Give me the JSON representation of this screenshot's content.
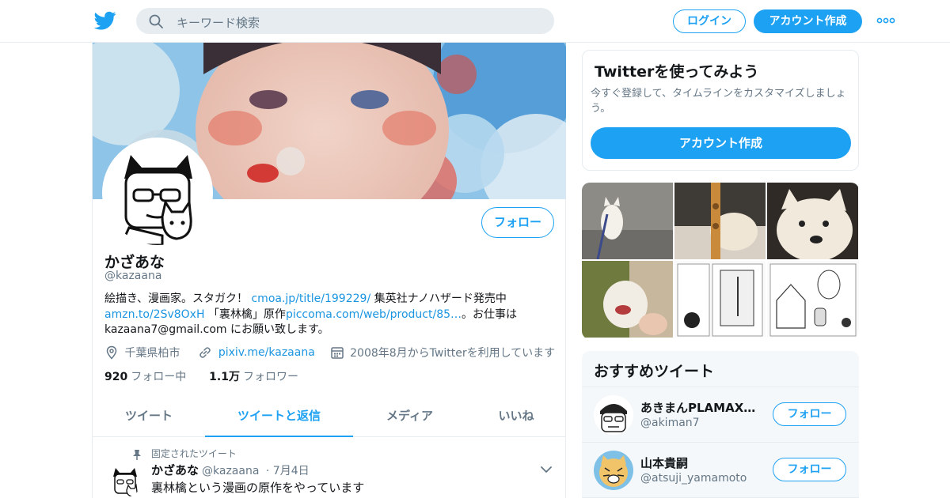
{
  "colors": {
    "brand": "#1da1f2",
    "link": "#1b95e0",
    "muted": "#657786",
    "text": "#14171a",
    "border": "#e6ecf0"
  },
  "header": {
    "logo_icon": "twitter-bird-icon",
    "search_placeholder": "キーワード検索",
    "search_icon": "search-icon",
    "login_label": "ログイン",
    "signup_label": "アカウント作成",
    "more_icon": "more-dots-icon"
  },
  "profile": {
    "name": "かざあな",
    "handle": "@kazaana",
    "follow_label": "フォロー",
    "bio": {
      "t1": "絵描き、漫画家。スタガク！ ",
      "l1": "cmoa.jp/title/199229/",
      "t2": " 集英社ナノハザード発売中",
      "l2": "amzn.to/2Sv8OxH",
      "t3": " 「裏林檎」原作",
      "l3": "piccoma.com/web/product/85…",
      "t4": "。お仕事は kazaana7@gmail.com にお願い致します。"
    },
    "location": "千葉県柏市",
    "website": "pixiv.me/kazaana",
    "joined": "2008年8月からTwitterを利用しています",
    "following_count": "920",
    "following_label": "フォロー中",
    "followers_count": "1.1万",
    "followers_label": "フォロワー"
  },
  "tabs": [
    {
      "label": "ツイート",
      "active": false
    },
    {
      "label": "ツイートと返信",
      "active": true
    },
    {
      "label": "メディア",
      "active": false
    },
    {
      "label": "いいね",
      "active": false
    }
  ],
  "pinned_tweet": {
    "pinned_label": "固定されたツイート",
    "name": "かざあな",
    "handle": "@kazaana",
    "date": "7月4日",
    "text": "裏林檎という漫画の原作をやっています"
  },
  "signup_card": {
    "title": "Twitterを使ってみよう",
    "description": "今すぐ登録して、タイムラインをカスタマイズしましょう。",
    "button_label": "アカウント作成"
  },
  "recommended": {
    "heading": "おすすめツイート",
    "items": [
      {
        "name": "あきまんPLAMAX「…",
        "handle": "@akiman7",
        "follow_label": "フォロー"
      },
      {
        "name": "山本貴嗣",
        "handle": "@atsuji_yamamoto",
        "follow_label": "フォロー"
      }
    ]
  }
}
